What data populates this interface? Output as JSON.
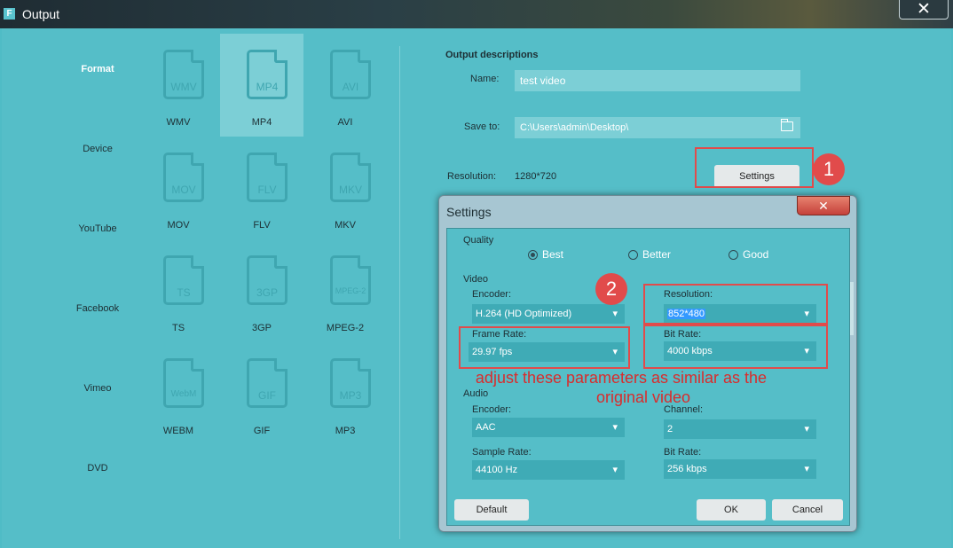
{
  "window": {
    "logo": "F",
    "title": "Output",
    "close": "✕"
  },
  "categories": [
    {
      "label": "Format",
      "active": true
    },
    {
      "label": "Device",
      "active": false
    },
    {
      "label": "YouTube",
      "active": false
    },
    {
      "label": "Facebook",
      "active": false
    },
    {
      "label": "Vimeo",
      "active": false
    },
    {
      "label": "DVD",
      "active": false
    }
  ],
  "formats": [
    {
      "icon_text": "WMV",
      "label": "WMV"
    },
    {
      "icon_text": "MP4",
      "label": "MP4",
      "selected": true
    },
    {
      "icon_text": "AVI",
      "label": "AVI"
    },
    {
      "icon_text": "MOV",
      "label": "MOV"
    },
    {
      "icon_text": "FLV",
      "label": "FLV"
    },
    {
      "icon_text": "MKV",
      "label": "MKV"
    },
    {
      "icon_text": "TS",
      "label": "TS"
    },
    {
      "icon_text": "3GP",
      "label": "3GP"
    },
    {
      "icon_text": "MPEG-2",
      "label": "MPEG-2"
    },
    {
      "icon_text": "WebM",
      "label": "WEBM"
    },
    {
      "icon_text": "GIF",
      "label": "GIF"
    },
    {
      "icon_text": "MP3",
      "label": "MP3"
    }
  ],
  "output": {
    "title": "Output descriptions",
    "name_label": "Name:",
    "name_value": "test video",
    "save_label": "Save to:",
    "save_value": "C:\\Users\\admin\\Desktop\\",
    "resolution_label": "Resolution:",
    "resolution_value": "1280*720",
    "settings_button": "Settings"
  },
  "annotations": {
    "step1": "1",
    "step2": "2",
    "note_line1": "adjust these parameters as similar as the",
    "note_line2": "original video"
  },
  "dialog": {
    "title": "Settings",
    "close": "✕",
    "quality_label": "Quality",
    "quality_options": [
      "Best",
      "Better",
      "Good"
    ],
    "quality_selected": "Best",
    "video_label": "Video",
    "encoder_label": "Encoder:",
    "encoder_value": "H.264 (HD Optimized)",
    "resolution_label": "Resolution:",
    "resolution_value": "852*480",
    "frame_rate_label": "Frame Rate:",
    "frame_rate_value": "29.97 fps",
    "bit_rate_label": "Bit Rate:",
    "bit_rate_value": "4000 kbps",
    "audio_label": "Audio",
    "audio_encoder_label": "Encoder:",
    "audio_encoder_value": "AAC",
    "channel_label": "Channel:",
    "channel_value": "2",
    "sample_rate_label": "Sample Rate:",
    "sample_rate_value": "44100 Hz",
    "audio_bit_rate_label": "Bit Rate:",
    "audio_bit_rate_value": "256 kbps",
    "default_button": "Default",
    "ok_button": "OK",
    "cancel_button": "Cancel"
  },
  "colors": {
    "accent": "#55bec8",
    "annotation": "#e14b4b"
  }
}
